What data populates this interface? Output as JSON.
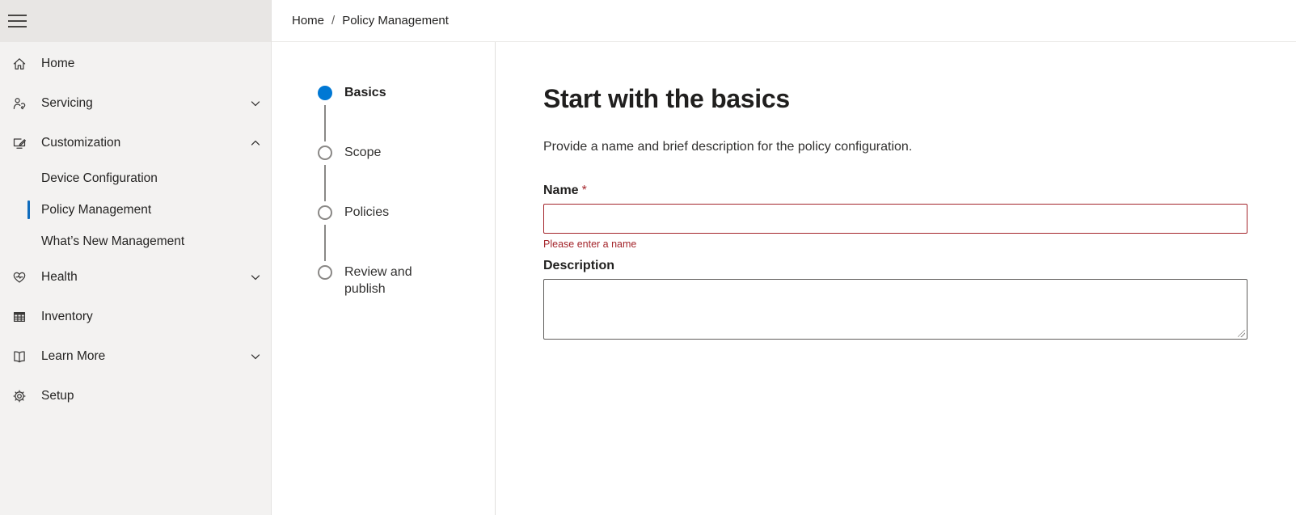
{
  "colors": {
    "accent": "#0078d4",
    "error": "#a4262c",
    "sidebar_bg": "#f3f2f1",
    "sidebar_top_bg": "#e8e6e4"
  },
  "sidebar": {
    "items": [
      {
        "label": "Home",
        "icon": "home-icon"
      },
      {
        "label": "Servicing",
        "icon": "servicing-icon",
        "chevron": "down"
      },
      {
        "label": "Customization",
        "icon": "customization-icon",
        "chevron": "up",
        "expanded": true,
        "children": [
          {
            "label": "Device Configuration",
            "selected": false
          },
          {
            "label": "Policy Management",
            "selected": true
          },
          {
            "label": "What’s New Management",
            "selected": false
          }
        ]
      },
      {
        "label": "Health",
        "icon": "health-icon",
        "chevron": "down"
      },
      {
        "label": "Inventory",
        "icon": "inventory-icon"
      },
      {
        "label": "Learn More",
        "icon": "learn-more-icon",
        "chevron": "down"
      },
      {
        "label": "Setup",
        "icon": "setup-icon"
      }
    ]
  },
  "breadcrumb": {
    "items": [
      "Home",
      "Policy Management"
    ],
    "separator": "/"
  },
  "wizard": {
    "steps": [
      {
        "label": "Basics",
        "state": "active"
      },
      {
        "label": "Scope",
        "state": "upcoming"
      },
      {
        "label": "Policies",
        "state": "upcoming"
      },
      {
        "label": "Review and publish",
        "state": "upcoming"
      }
    ]
  },
  "content": {
    "title": "Start with the basics",
    "subtitle": "Provide a name and brief description for the policy configuration.",
    "fields": {
      "name": {
        "label": "Name",
        "required_marker": "*",
        "value": "",
        "error": "Please enter a name"
      },
      "description": {
        "label": "Description",
        "value": ""
      }
    }
  }
}
